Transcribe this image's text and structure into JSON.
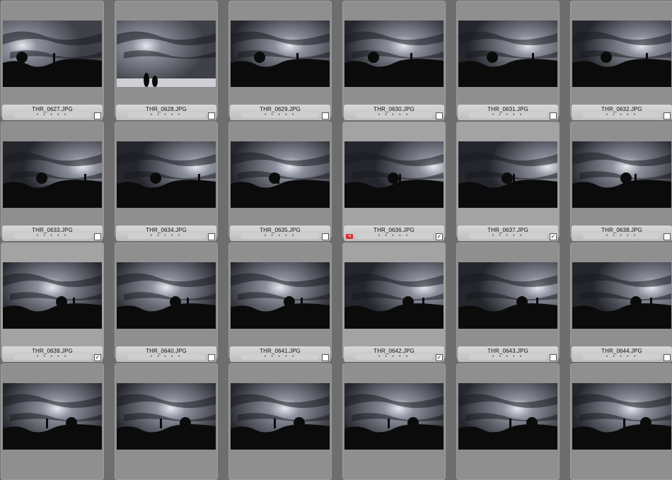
{
  "browser": {
    "cells": [
      {
        "filename": "THR_0627.JPG",
        "rating_dots": "• • • • •",
        "checked": false,
        "scene": 1
      },
      {
        "filename": "THR_0628.JPG",
        "rating_dots": "• • • • •",
        "checked": false,
        "scene": 2
      },
      {
        "filename": "THR_0629.JPG",
        "rating_dots": "• • • • •",
        "checked": false,
        "scene": 3
      },
      {
        "filename": "THR_0630.JPG",
        "rating_dots": "• • • • •",
        "checked": false,
        "scene": 3
      },
      {
        "filename": "THR_0631.JPG",
        "rating_dots": "• • • • •",
        "checked": false,
        "scene": 4
      },
      {
        "filename": "THR_0632.JPG",
        "rating_dots": "• • • • •",
        "checked": false,
        "scene": 4
      },
      {
        "filename": "THR_0633.JPG",
        "rating_dots": "• • • • •",
        "checked": false,
        "scene": 5
      },
      {
        "filename": "THR_0634.JPG",
        "rating_dots": "• • • • •",
        "checked": false,
        "scene": 5
      },
      {
        "filename": "THR_0635.JPG",
        "rating_dots": "• • • • •",
        "checked": false,
        "scene": 6
      },
      {
        "filename": "THR_0636.JPG",
        "rating_dots": "• • • • •",
        "checked": true,
        "flagged": true,
        "scene": 7
      },
      {
        "filename": "THR_0637.JPG",
        "rating_dots": "• • • • •",
        "checked": true,
        "scene": 7
      },
      {
        "filename": "THR_0638.JPG",
        "rating_dots": "• • • • •",
        "checked": false,
        "scene": 8
      },
      {
        "filename": "THR_0639.JPG",
        "rating_dots": "• • • • •",
        "checked": true,
        "scene": 9
      },
      {
        "filename": "THR_0640.JPG",
        "rating_dots": "• • • • •",
        "checked": false,
        "scene": 9
      },
      {
        "filename": "THR_0641.JPG",
        "rating_dots": "• • • • •",
        "checked": false,
        "scene": 9
      },
      {
        "filename": "THR_0642.JPG",
        "rating_dots": "• • • • •",
        "checked": true,
        "scene": 10
      },
      {
        "filename": "THR_0643.JPG",
        "rating_dots": "• • • • •",
        "checked": false,
        "scene": 10
      },
      {
        "filename": "THR_0644.JPG",
        "rating_dots": "• • • • •",
        "checked": false,
        "scene": 10
      },
      {
        "filename": "",
        "rating_dots": "",
        "checked": false,
        "scene": 11
      },
      {
        "filename": "",
        "rating_dots": "",
        "checked": false,
        "scene": 11
      },
      {
        "filename": "",
        "rating_dots": "",
        "checked": false,
        "scene": 11
      },
      {
        "filename": "",
        "rating_dots": "",
        "checked": false,
        "scene": 11
      },
      {
        "filename": "",
        "rating_dots": "",
        "checked": false,
        "scene": 12
      },
      {
        "filename": "",
        "rating_dots": "",
        "checked": false,
        "scene": 12
      }
    ],
    "check_glyph": "✓",
    "flag_glyph": "◂",
    "colors": {
      "background": "#6e6e6e",
      "cell": "#8f8f8f",
      "label_bar": "#cfcfcf",
      "flag": "#d33333"
    }
  }
}
